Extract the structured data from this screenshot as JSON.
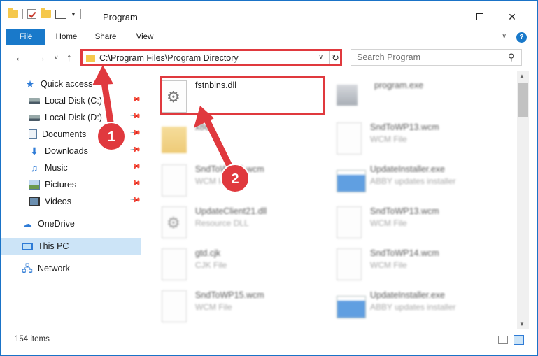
{
  "window": {
    "title": "Program"
  },
  "ribbon": {
    "tabs": [
      "File",
      "Home",
      "Share",
      "View"
    ]
  },
  "address": {
    "path": "C:\\Program Files\\Program Directory"
  },
  "search": {
    "placeholder": "Search Program"
  },
  "sidebar": {
    "items": [
      {
        "label": "Quick access",
        "icon": "star-icon",
        "pinned": false
      },
      {
        "label": "Local Disk (C:)",
        "icon": "drive-icon",
        "pinned": true
      },
      {
        "label": "Local Disk (D:)",
        "icon": "drive-icon",
        "pinned": true
      },
      {
        "label": "Documents",
        "icon": "documents-icon",
        "pinned": true
      },
      {
        "label": "Downloads",
        "icon": "download-icon",
        "pinned": true
      },
      {
        "label": "Music",
        "icon": "music-icon",
        "pinned": true
      },
      {
        "label": "Pictures",
        "icon": "pictures-icon",
        "pinned": true
      },
      {
        "label": "Videos",
        "icon": "video-icon",
        "pinned": true
      },
      {
        "label": "OneDrive",
        "icon": "cloud-icon",
        "pinned": false
      },
      {
        "label": "This PC",
        "icon": "computer-icon",
        "pinned": false,
        "selected": true
      },
      {
        "label": "Network",
        "icon": "network-icon",
        "pinned": false
      }
    ]
  },
  "files": {
    "highlighted": {
      "name": "fstnbins.dll",
      "type": "",
      "icon": "dll-icon"
    },
    "items": [
      {
        "name": "program.exe",
        "type": "",
        "icon": "exe-icon"
      },
      {
        "name": "x86",
        "type": "",
        "icon": "folder-icon"
      },
      {
        "name": "SndToWP13.wcm",
        "type": "WCM File",
        "icon": "file-icon"
      },
      {
        "name": "SndToWP13.wcm",
        "type": "WCM File",
        "icon": "file-icon"
      },
      {
        "name": "UpdateInstaller.exe",
        "type": "ABBY updates installer",
        "icon": "installer-icon"
      },
      {
        "name": "UpdateClient21.dll",
        "type": "Resource DLL",
        "icon": "dll-icon"
      },
      {
        "name": "SndToWP13.wcm",
        "type": "WCM File",
        "icon": "file-icon"
      },
      {
        "name": "gtd.cjk",
        "type": "CJK File",
        "icon": "file-icon"
      },
      {
        "name": "SndToWP14.wcm",
        "type": "WCM File",
        "icon": "file-icon"
      },
      {
        "name": "SndToWP15.wcm",
        "type": "WCM File",
        "icon": "file-icon"
      },
      {
        "name": "UpdateInstaller.exe",
        "type": "ABBY updates installer",
        "icon": "installer-icon"
      }
    ]
  },
  "status": {
    "count": "154 items"
  },
  "annotations": {
    "step1": "1",
    "step2": "2",
    "color": "#e0393e"
  }
}
